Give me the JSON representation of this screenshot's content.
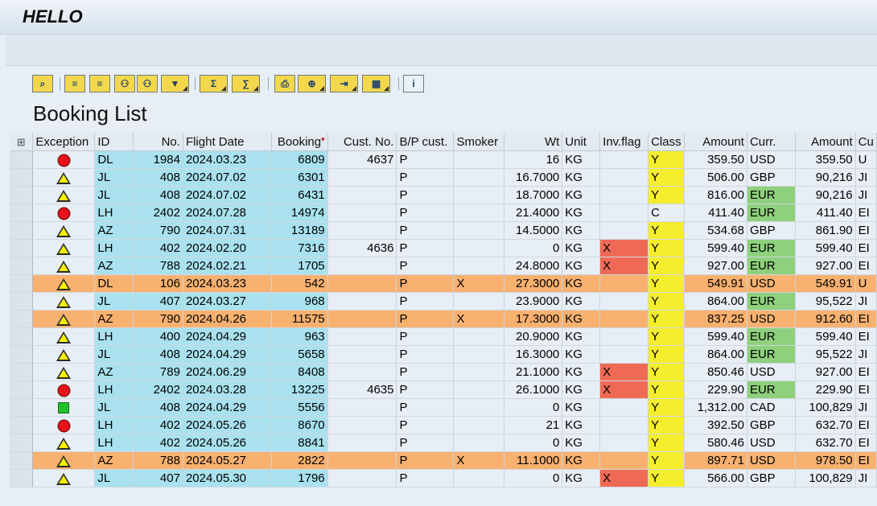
{
  "window": {
    "title": "HELLO"
  },
  "toolbar": {
    "buttons": [
      {
        "name": "details-button",
        "icon": "details-icon",
        "drop": false,
        "blue": false
      },
      {
        "name": "sort-ascending-button",
        "icon": "sort-ascending-icon",
        "drop": false,
        "blue": false
      },
      {
        "name": "sort-descending-button",
        "icon": "sort-descending-icon",
        "drop": false,
        "blue": false
      },
      {
        "name": "find-button",
        "icon": "binoculars-icon",
        "drop": false,
        "blue": false
      },
      {
        "name": "find-next-button",
        "icon": "find-next-icon",
        "drop": false,
        "blue": false
      },
      {
        "name": "filter-button",
        "icon": "filter-icon",
        "drop": true,
        "blue": false
      },
      {
        "name": "total-button",
        "icon": "sum-icon",
        "drop": true,
        "blue": false
      },
      {
        "name": "subtotal-button",
        "icon": "subtotal-icon",
        "drop": true,
        "blue": false
      },
      {
        "name": "print-preview-button",
        "icon": "print-icon",
        "drop": false,
        "blue": false
      },
      {
        "name": "views-button",
        "icon": "views-icon",
        "drop": true,
        "blue": false
      },
      {
        "name": "export-button",
        "icon": "export-icon",
        "drop": true,
        "blue": false
      },
      {
        "name": "layout-button",
        "icon": "layout-icon",
        "drop": true,
        "blue": false
      },
      {
        "name": "info-button",
        "icon": "info-icon",
        "drop": false,
        "blue": true
      }
    ]
  },
  "page": {
    "heading": "Booking List"
  },
  "table": {
    "columns": [
      {
        "key": "exception",
        "label": "Exception",
        "align": "l"
      },
      {
        "key": "id",
        "label": "ID",
        "align": "l"
      },
      {
        "key": "no",
        "label": "No.",
        "align": "r"
      },
      {
        "key": "date",
        "label": "Flight Date",
        "align": "l"
      },
      {
        "key": "booking",
        "label": "Booking",
        "align": "r",
        "sorted": true
      },
      {
        "key": "cust",
        "label": "Cust. No.",
        "align": "r"
      },
      {
        "key": "bp",
        "label": "B/P cust.",
        "align": "l"
      },
      {
        "key": "smoker",
        "label": "Smoker",
        "align": "l"
      },
      {
        "key": "wt",
        "label": "Wt",
        "align": "r"
      },
      {
        "key": "unit",
        "label": "Unit",
        "align": "l"
      },
      {
        "key": "inv",
        "label": "Inv.flag",
        "align": "l"
      },
      {
        "key": "cls",
        "label": "Class",
        "align": "l"
      },
      {
        "key": "amount",
        "label": "Amount",
        "align": "r"
      },
      {
        "key": "curr",
        "label": "Curr.",
        "align": "l"
      },
      {
        "key": "amount2",
        "label": "Amount",
        "align": "r"
      },
      {
        "key": "cu2",
        "label": "Cu",
        "align": "l"
      }
    ],
    "status_colors": {
      "key": "#a9e2ee",
      "orange": "#f9b170",
      "yellow": "#f5ee2e",
      "green": "#8ed07c",
      "red": "#ef6a55"
    },
    "rows": [
      {
        "exception": "red",
        "orange": false,
        "id": "DL",
        "no": "1984",
        "date": "2024.03.23",
        "booking": "6809",
        "cust": "4637",
        "bp": "P",
        "smoker": "",
        "wt": "16",
        "unit": "KG",
        "inv": "",
        "cls": "Y",
        "amount": "359.50",
        "curr": "USD",
        "currGreen": false,
        "amount2": "359.50",
        "cu2": "U"
      },
      {
        "exception": "warn",
        "orange": false,
        "id": "JL",
        "no": "408",
        "date": "2024.07.02",
        "booking": "6301",
        "cust": "",
        "bp": "P",
        "smoker": "",
        "wt": "16.7000",
        "unit": "KG",
        "inv": "",
        "cls": "Y",
        "amount": "506.00",
        "curr": "GBP",
        "currGreen": false,
        "amount2": "90,216",
        "cu2": "JI"
      },
      {
        "exception": "warn",
        "orange": false,
        "id": "JL",
        "no": "408",
        "date": "2024.07.02",
        "booking": "6431",
        "cust": "",
        "bp": "P",
        "smoker": "",
        "wt": "18.7000",
        "unit": "KG",
        "inv": "",
        "cls": "Y",
        "amount": "816.00",
        "curr": "EUR",
        "currGreen": true,
        "amount2": "90,216",
        "cu2": "JI"
      },
      {
        "exception": "red",
        "orange": false,
        "id": "LH",
        "no": "2402",
        "date": "2024.07.28",
        "booking": "14974",
        "cust": "",
        "bp": "P",
        "smoker": "",
        "wt": "21.4000",
        "unit": "KG",
        "inv": "",
        "cls": "C",
        "amount": "411.40",
        "curr": "EUR",
        "currGreen": true,
        "amount2": "411.40",
        "cu2": "EI"
      },
      {
        "exception": "warn",
        "orange": false,
        "id": "AZ",
        "no": "790",
        "date": "2024.07.31",
        "booking": "13189",
        "cust": "",
        "bp": "P",
        "smoker": "",
        "wt": "14.5000",
        "unit": "KG",
        "inv": "",
        "cls": "Y",
        "amount": "534.68",
        "curr": "GBP",
        "currGreen": false,
        "amount2": "861.90",
        "cu2": "EI"
      },
      {
        "exception": "warn",
        "orange": false,
        "id": "LH",
        "no": "402",
        "date": "2024.02.20",
        "booking": "7316",
        "cust": "4636",
        "bp": "P",
        "smoker": "",
        "wt": "0",
        "unit": "KG",
        "inv": "X",
        "cls": "Y",
        "amount": "599.40",
        "curr": "EUR",
        "currGreen": true,
        "amount2": "599.40",
        "cu2": "EI"
      },
      {
        "exception": "warn",
        "orange": false,
        "id": "AZ",
        "no": "788",
        "date": "2024.02.21",
        "booking": "1705",
        "cust": "",
        "bp": "P",
        "smoker": "",
        "wt": "24.8000",
        "unit": "KG",
        "inv": "X",
        "cls": "Y",
        "amount": "927.00",
        "curr": "EUR",
        "currGreen": true,
        "amount2": "927.00",
        "cu2": "EI"
      },
      {
        "exception": "warn",
        "orange": true,
        "id": "DL",
        "no": "106",
        "date": "2024.03.23",
        "booking": "542",
        "cust": "",
        "bp": "P",
        "smoker": "X",
        "wt": "27.3000",
        "unit": "KG",
        "inv": "",
        "cls": "Y",
        "amount": "549.91",
        "curr": "USD",
        "currGreen": false,
        "amount2": "549.91",
        "cu2": "U"
      },
      {
        "exception": "warn",
        "orange": false,
        "id": "JL",
        "no": "407",
        "date": "2024.03.27",
        "booking": "968",
        "cust": "",
        "bp": "P",
        "smoker": "",
        "wt": "23.9000",
        "unit": "KG",
        "inv": "",
        "cls": "Y",
        "amount": "864.00",
        "curr": "EUR",
        "currGreen": true,
        "amount2": "95,522",
        "cu2": "JI"
      },
      {
        "exception": "warn",
        "orange": true,
        "id": "AZ",
        "no": "790",
        "date": "2024.04.26",
        "booking": "11575",
        "cust": "",
        "bp": "P",
        "smoker": "X",
        "wt": "17.3000",
        "unit": "KG",
        "inv": "",
        "cls": "Y",
        "amount": "837.25",
        "curr": "USD",
        "currGreen": false,
        "amount2": "912.60",
        "cu2": "EI"
      },
      {
        "exception": "warn",
        "orange": false,
        "id": "LH",
        "no": "400",
        "date": "2024.04.29",
        "booking": "963",
        "cust": "",
        "bp": "P",
        "smoker": "",
        "wt": "20.9000",
        "unit": "KG",
        "inv": "",
        "cls": "Y",
        "amount": "599.40",
        "curr": "EUR",
        "currGreen": true,
        "amount2": "599.40",
        "cu2": "EI"
      },
      {
        "exception": "warn",
        "orange": false,
        "id": "JL",
        "no": "408",
        "date": "2024.04.29",
        "booking": "5658",
        "cust": "",
        "bp": "P",
        "smoker": "",
        "wt": "16.3000",
        "unit": "KG",
        "inv": "",
        "cls": "Y",
        "amount": "864.00",
        "curr": "EUR",
        "currGreen": true,
        "amount2": "95,522",
        "cu2": "JI"
      },
      {
        "exception": "warn",
        "orange": false,
        "id": "AZ",
        "no": "789",
        "date": "2024.06.29",
        "booking": "8408",
        "cust": "",
        "bp": "P",
        "smoker": "",
        "wt": "21.1000",
        "unit": "KG",
        "inv": "X",
        "cls": "Y",
        "amount": "850.46",
        "curr": "USD",
        "currGreen": false,
        "amount2": "927.00",
        "cu2": "EI"
      },
      {
        "exception": "red",
        "orange": false,
        "id": "LH",
        "no": "2402",
        "date": "2024.03.28",
        "booking": "13225",
        "cust": "4635",
        "bp": "P",
        "smoker": "",
        "wt": "26.1000",
        "unit": "KG",
        "inv": "X",
        "cls": "Y",
        "amount": "229.90",
        "curr": "EUR",
        "currGreen": true,
        "amount2": "229.90",
        "cu2": "EI"
      },
      {
        "exception": "green",
        "orange": false,
        "id": "JL",
        "no": "408",
        "date": "2024.04.29",
        "booking": "5556",
        "cust": "",
        "bp": "P",
        "smoker": "",
        "wt": "0",
        "unit": "KG",
        "inv": "",
        "cls": "Y",
        "amount": "1,312.00",
        "curr": "CAD",
        "currGreen": false,
        "amount2": "100,829",
        "cu2": "JI"
      },
      {
        "exception": "red",
        "orange": false,
        "id": "LH",
        "no": "402",
        "date": "2024.05.26",
        "booking": "8670",
        "cust": "",
        "bp": "P",
        "smoker": "",
        "wt": "21",
        "unit": "KG",
        "inv": "",
        "cls": "Y",
        "amount": "392.50",
        "curr": "GBP",
        "currGreen": false,
        "amount2": "632.70",
        "cu2": "EI"
      },
      {
        "exception": "warn",
        "orange": false,
        "id": "LH",
        "no": "402",
        "date": "2024.05.26",
        "booking": "8841",
        "cust": "",
        "bp": "P",
        "smoker": "",
        "wt": "0",
        "unit": "KG",
        "inv": "",
        "cls": "Y",
        "amount": "580.46",
        "curr": "USD",
        "currGreen": false,
        "amount2": "632.70",
        "cu2": "EI"
      },
      {
        "exception": "warn",
        "orange": true,
        "id": "AZ",
        "no": "788",
        "date": "2024.05.27",
        "booking": "2822",
        "cust": "",
        "bp": "P",
        "smoker": "X",
        "wt": "11.1000",
        "unit": "KG",
        "inv": "",
        "cls": "Y",
        "amount": "897.71",
        "curr": "USD",
        "currGreen": false,
        "amount2": "978.50",
        "cu2": "EI"
      },
      {
        "exception": "warn",
        "orange": false,
        "id": "JL",
        "no": "407",
        "date": "2024.05.30",
        "booking": "1796",
        "cust": "",
        "bp": "P",
        "smoker": "",
        "wt": "0",
        "unit": "KG",
        "inv": "X",
        "cls": "Y",
        "amount": "566.00",
        "curr": "GBP",
        "currGreen": false,
        "amount2": "100,829",
        "cu2": "JI"
      }
    ]
  }
}
